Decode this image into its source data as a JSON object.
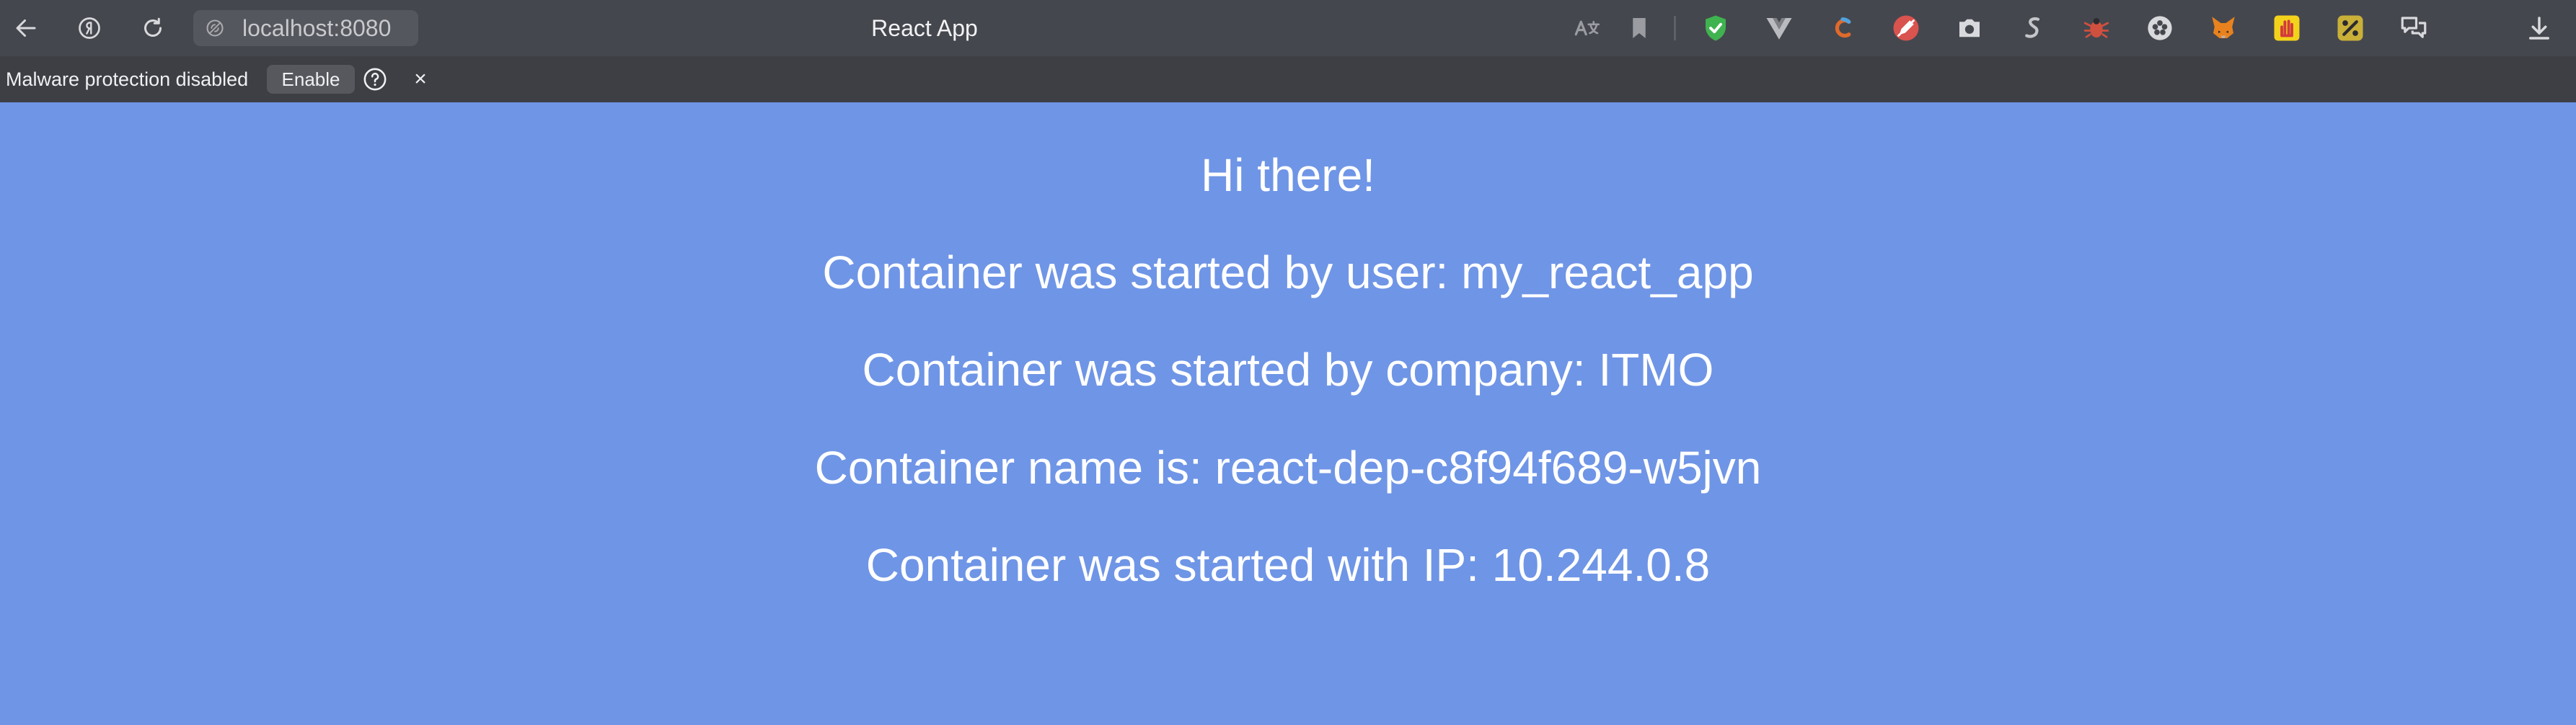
{
  "browser": {
    "url": "localhost:8080",
    "page_title": "React App",
    "icons": {
      "back": "arrow-left-icon",
      "yandex": "yandex-logo-icon",
      "reload": "reload-icon",
      "site_info": "site-info-icon"
    },
    "extensions": [
      {
        "name": "translate-icon",
        "color": "#9a9ca2"
      },
      {
        "name": "bookmark-icon",
        "color": "#9a9ca2"
      },
      {
        "name": "adguard-shield-icon",
        "color": "#3fb34f"
      },
      {
        "name": "vue-devtools-icon",
        "color": "#b9bbc0"
      },
      {
        "name": "colorzilla-icon",
        "color": "#e06a2b"
      },
      {
        "name": "no-edit-icon",
        "color": "#d9534f"
      },
      {
        "name": "camera-icon",
        "color": "#d8d9dc"
      },
      {
        "name": "script-s-icon",
        "color": "#c3c5ca"
      },
      {
        "name": "bug-icon",
        "color": "#d0503f"
      },
      {
        "name": "flower-icon",
        "color": "#d8d9dc"
      },
      {
        "name": "metamask-fox-icon",
        "color": "#e8821e"
      },
      {
        "name": "stop-hand-icon",
        "color": "#f3d21b"
      },
      {
        "name": "percent-coupon-icon",
        "color": "#c9b038"
      },
      {
        "name": "chat-bubbles-icon",
        "color": "#d8d9dc"
      },
      {
        "name": "download-icon",
        "color": "#d8d9dc"
      }
    ]
  },
  "infobar": {
    "message": "Malware protection disabled",
    "enable_label": "Enable",
    "help_label": "?",
    "close_label": "×"
  },
  "page": {
    "greeting": "Hi there!",
    "user_line": "Container was started by user: my_react_app",
    "company_line": "Container was started by company: ITMO",
    "name_line": "Container name is: react-dep-c8f94f689-w5jvn",
    "ip_line": "Container was started with IP: 10.244.0.8",
    "background_color": "#6f95e6"
  }
}
